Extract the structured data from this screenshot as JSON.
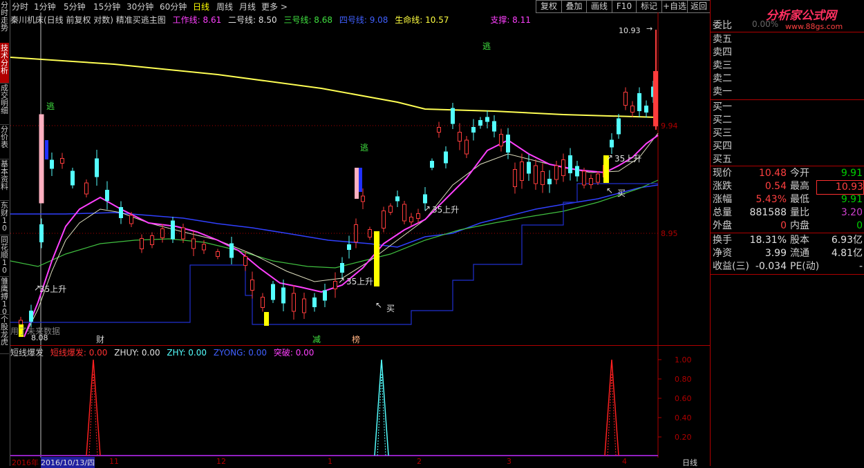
{
  "left_tabs": [
    "分时走势",
    "技术分析",
    "成交明细",
    "分价表",
    "基本资料",
    "东财10",
    "同花顺10",
    "雏鹰搏10",
    "个股龙虎"
  ],
  "periods": [
    "分时",
    "1分钟",
    "5分钟",
    "15分钟",
    "30分钟",
    "60分钟",
    "日线",
    "周线",
    "月线",
    "更多 >"
  ],
  "active_period": "日线",
  "toolbar": [
    "复权",
    "叠加",
    "画线",
    "F10",
    "标记",
    "+自选",
    "返回"
  ],
  "info": {
    "title": "秦川机床(日线 前复权 对数) 精准买逃主图",
    "work_label": "工作线: 8.61",
    "line2": "二号线: 8.50",
    "line3": "三号线: 8.68",
    "line4": "四号线: 9.08",
    "life": "生命线: 10.57",
    "support": "支撑: 8.11"
  },
  "watermark": {
    "brand": "分析家公式网",
    "url": "www.88gs.com"
  },
  "price_axis": [
    "9.94",
    "8.95"
  ],
  "price_marks": {
    "high": "10.93",
    "low": "8.08"
  },
  "chart_labels": {
    "escape": [
      "逃",
      "逃",
      "逃"
    ],
    "up35": [
      "35上升",
      "35上升",
      "35上升",
      "35上升"
    ],
    "buy": [
      "买",
      "买"
    ],
    "chars": [
      "财",
      "减",
      "榜"
    ],
    "use_future": "用了未来数据"
  },
  "sub": {
    "title": "短线爆发",
    "items": [
      "短线爆发: 0.00",
      "ZHUY: 0.00",
      "ZHY: 0.00",
      "ZYONG: 0.00",
      "突破: 0.00"
    ],
    "axis": [
      "1.00",
      "0.80",
      "0.60",
      "0.40",
      "0.20"
    ]
  },
  "dates": [
    "2016年",
    "2016/10/13/四",
    "11",
    "12",
    "1",
    "2",
    "3",
    "4"
  ],
  "period_label": "日线",
  "orderbook": {
    "weibi": "委比",
    "weibi_val": "0.00%",
    "sell": [
      "卖五",
      "卖四",
      "卖三",
      "卖二",
      "卖一"
    ],
    "buy": [
      "买一",
      "买二",
      "买三",
      "买四",
      "买五"
    ]
  },
  "quote": [
    {
      "l1": "现价",
      "v1": "10.48",
      "c1": "red",
      "l2": "今开",
      "v2": "9.91",
      "c2": "green"
    },
    {
      "l1": "涨跌",
      "v1": "0.54",
      "c1": "red",
      "l2": "最高",
      "v2": "10.93",
      "c2": "red"
    },
    {
      "l1": "涨幅",
      "v1": "5.43%",
      "c1": "red",
      "l2": "最低",
      "v2": "9.91",
      "c2": "green"
    },
    {
      "l1": "总量",
      "v1": "881588",
      "c1": "white",
      "l2": "量比",
      "v2": "3.20",
      "c2": "magenta"
    },
    {
      "l1": "外盘",
      "v1": "0",
      "c1": "red",
      "l2": "内盘",
      "v2": "0",
      "c2": "green"
    }
  ],
  "fin": [
    {
      "l1": "换手",
      "v1": "18.31%",
      "l2": "股本",
      "v2": "6.93亿"
    },
    {
      "l1": "净资",
      "v1": "3.99",
      "l2": "流通",
      "v2": "4.81亿"
    },
    {
      "l1": "收益(三)",
      "v1": "-0.034",
      "l2": "PE(动)",
      "v2": "-"
    }
  ],
  "colors": {
    "up": "#ff3c3c",
    "down": "#54ffff",
    "ma": "#ffff54",
    "work": "#ff40ff",
    "bg": "#000000",
    "grid": "#b00000"
  }
}
